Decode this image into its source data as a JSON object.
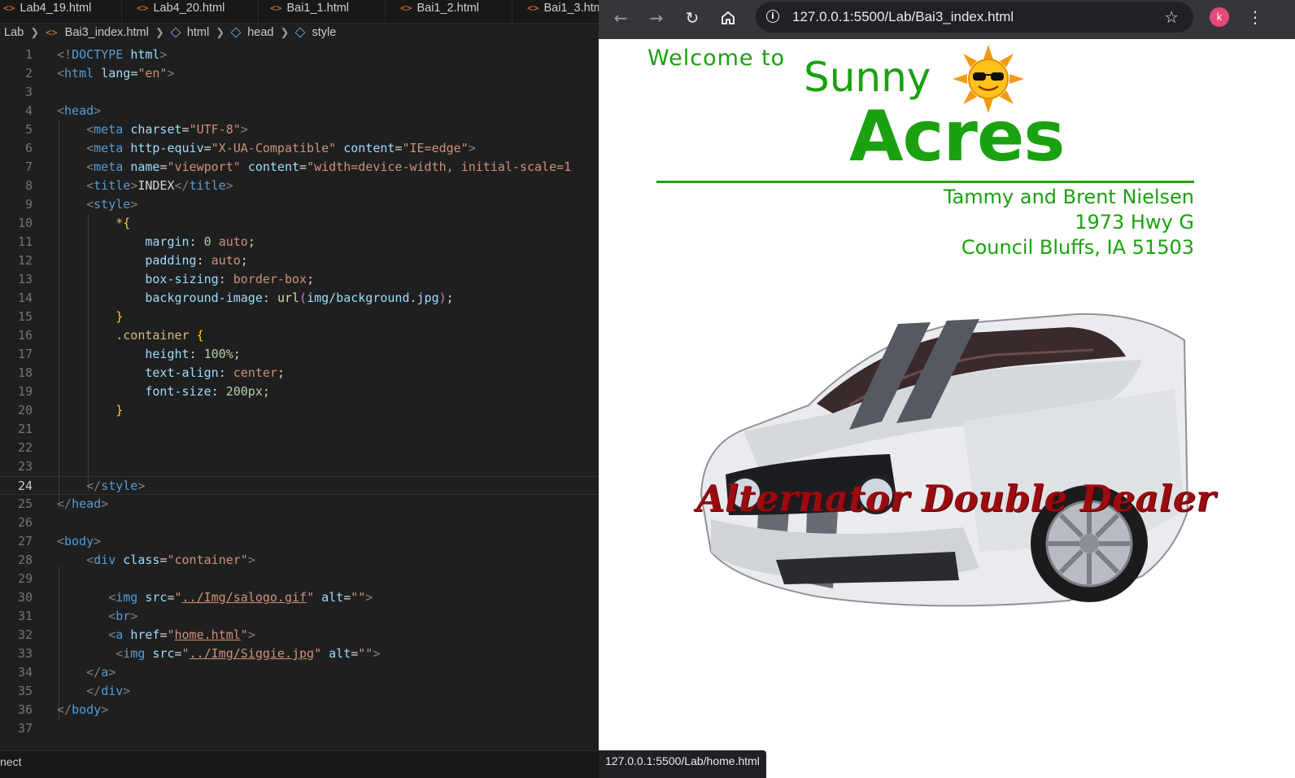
{
  "editor": {
    "tabs": [
      {
        "label": "Lab4_19.html"
      },
      {
        "label": "Lab4_20.html"
      },
      {
        "label": "Bai1_1.html"
      },
      {
        "label": "Bai1_2.html"
      },
      {
        "label": "Bai1_3.htm"
      }
    ],
    "breadcrumb": {
      "folder": "Lab",
      "file": "Bai3_index.html",
      "html": "html",
      "head": "head",
      "style": "style"
    },
    "active_line": 24,
    "status_text": "nect"
  },
  "browser": {
    "url": "127.0.0.1:5500/Lab/Bai3_index.html",
    "avatar_letter": "k",
    "status_url": "127.0.0.1:5500/Lab/home.html",
    "page": {
      "welcome": "Welcome to",
      "sunny": "Sunny",
      "acres": "Acres",
      "owners": "Tammy and Brent Nielsen",
      "street": "1973 Hwy G",
      "city": "Council Bluffs, IA  51503",
      "slogan": "Alternator Double Dealer",
      "brand_color": "#1aa10f",
      "slogan_color": "#9b0b10"
    }
  }
}
